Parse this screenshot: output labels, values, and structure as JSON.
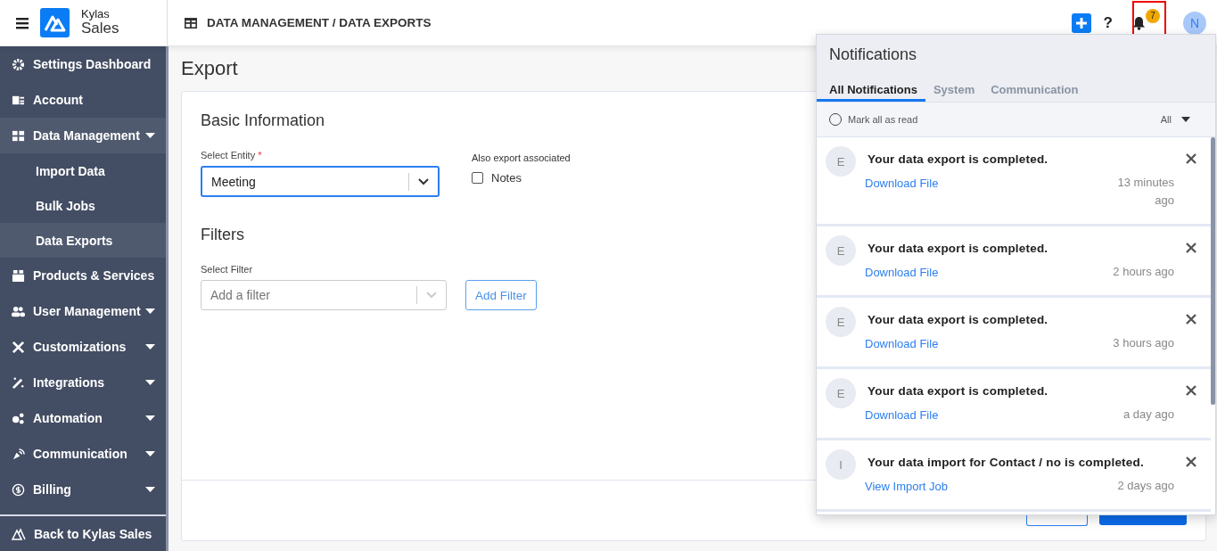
{
  "header": {
    "brand_top": "Kylas",
    "brand_bottom": "Sales",
    "breadcrumb": "DATA MANAGEMENT / DATA EXPORTS",
    "notification_count": "7",
    "avatar": "N",
    "help": "?"
  },
  "sidebar": {
    "items": [
      {
        "label": "Settings Dashboard",
        "kind": "link"
      },
      {
        "label": "Account",
        "kind": "link"
      },
      {
        "label": "Data Management",
        "kind": "group",
        "expanded": true,
        "children": [
          {
            "label": "Import Data",
            "selected": false
          },
          {
            "label": "Bulk Jobs",
            "selected": false
          },
          {
            "label": "Data Exports",
            "selected": true
          }
        ]
      },
      {
        "label": "Products & Services",
        "kind": "link"
      },
      {
        "label": "User Management",
        "kind": "group",
        "expanded": false
      },
      {
        "label": "Customizations",
        "kind": "group",
        "expanded": false
      },
      {
        "label": "Integrations",
        "kind": "group",
        "expanded": false
      },
      {
        "label": "Automation",
        "kind": "group",
        "expanded": false
      },
      {
        "label": "Communication",
        "kind": "group",
        "expanded": false
      },
      {
        "label": "Billing",
        "kind": "group",
        "expanded": false
      }
    ],
    "footer": "Back to Kylas Sales"
  },
  "page": {
    "title": "Export",
    "basic": {
      "heading": "Basic Information",
      "entity_label": "Select Entity",
      "required_mark": "*",
      "entity_value": "Meeting",
      "entity_focused": true,
      "associated_label": "Also export associated",
      "notes": {
        "label": "Notes",
        "checked": false
      }
    },
    "filters": {
      "heading": "Filters",
      "filter_label": "Select Filter",
      "placeholder": "Add a filter",
      "add_button": "Add Filter"
    }
  },
  "notifications": {
    "title": "Notifications",
    "tabs": [
      {
        "label": "All Notifications",
        "selected": true
      },
      {
        "label": "System",
        "selected": false
      },
      {
        "label": "Communication",
        "selected": false
      }
    ],
    "mark_all": {
      "label": "Mark all as read",
      "checked": false
    },
    "filter": "All",
    "items": [
      {
        "initial": "E",
        "message": "Your data export is completed.",
        "link": "Download File",
        "time": "13 minutes ago"
      },
      {
        "initial": "E",
        "message": "Your data export is completed.",
        "link": "Download File",
        "time": "2 hours ago"
      },
      {
        "initial": "E",
        "message": "Your data export is completed.",
        "link": "Download File",
        "time": "3 hours ago"
      },
      {
        "initial": "E",
        "message": "Your data export is completed.",
        "link": "Download File",
        "time": "a day ago"
      },
      {
        "initial": "I",
        "message": "Your data import for Contact / no is completed.",
        "link": "View Import Job",
        "time": "2 days ago"
      }
    ]
  }
}
